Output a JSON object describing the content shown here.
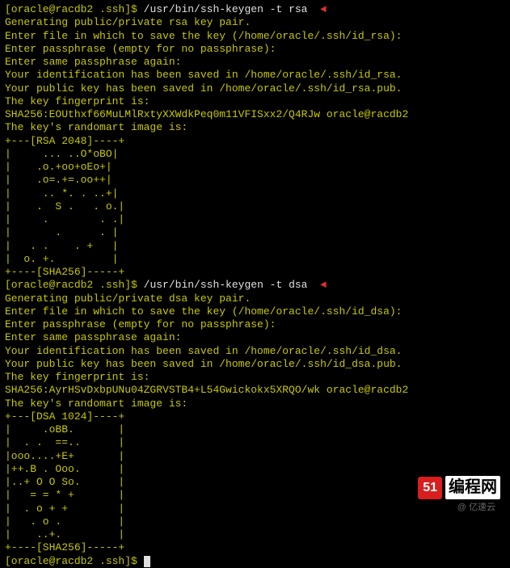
{
  "rsa": {
    "prompt": "[oracle@racdb2 .ssh]$ ",
    "command": "/usr/bin/ssh-keygen -t rsa",
    "arrow": "◄",
    "gen": "Generating public/private rsa key pair.",
    "enter_file": "Enter file in which to save the key (/home/oracle/.ssh/id_rsa):",
    "enter_pass": "Enter passphrase (empty for no passphrase):",
    "enter_same": "Enter same passphrase again:",
    "ident_saved": "Your identification has been saved in /home/oracle/.ssh/id_rsa.",
    "pub_saved": "Your public key has been saved in /home/oracle/.ssh/id_rsa.pub.",
    "fp_is": "The key fingerprint is:",
    "fp": "SHA256:EOUthxf66MuLMlRxtyXXWdkPeq0m11VFISxx2/Q4RJw oracle@racdb2",
    "randomart_is": "The key's randomart image is:",
    "art": [
      "+---[RSA 2048]----+",
      "|     ... ..O*oBO|",
      "|    .o.+oo+oEo+|",
      "|    .o=.+=.oo++|",
      "|     .. *. . ..+|",
      "|    .  S .   . o.|",
      "|     .        . .|",
      "|       .      . |",
      "|   . .    . +   |",
      "|  o. +.         |",
      "+----[SHA256]-----+"
    ]
  },
  "dsa": {
    "prompt": "[oracle@racdb2 .ssh]$ ",
    "command": "/usr/bin/ssh-keygen -t dsa",
    "arrow": "◄",
    "gen": "Generating public/private dsa key pair.",
    "enter_file": "Enter file in which to save the key (/home/oracle/.ssh/id_dsa):",
    "enter_pass": "Enter passphrase (empty for no passphrase):",
    "enter_same": "Enter same passphrase again:",
    "ident_saved": "Your identification has been saved in /home/oracle/.ssh/id_dsa.",
    "pub_saved": "Your public key has been saved in /home/oracle/.ssh/id_dsa.pub.",
    "fp_is": "The key fingerprint is:",
    "fp": "SHA256:AyrHSvDxbpUNu04ZGRVSTB4+L54Gwickokx5XRQO/wk oracle@racdb2",
    "randomart_is": "The key's randomart image is:",
    "art": [
      "+---[DSA 1024]----+",
      "|     .oBB.       |",
      "|  . .  ==..      |",
      "|ooo....+E+       |",
      "|++.B . Ooo.      |",
      "|..+ O O So.      |",
      "|   = = * +       |",
      "|  . o + +        |",
      "|   . o .         |",
      "|    ..+.         |",
      "+----[SHA256]-----+"
    ]
  },
  "final_prompt": "[oracle@racdb2 .ssh]$ ",
  "logo": {
    "badge": "51",
    "text": "编程网"
  },
  "watermark": "@ 亿速云"
}
